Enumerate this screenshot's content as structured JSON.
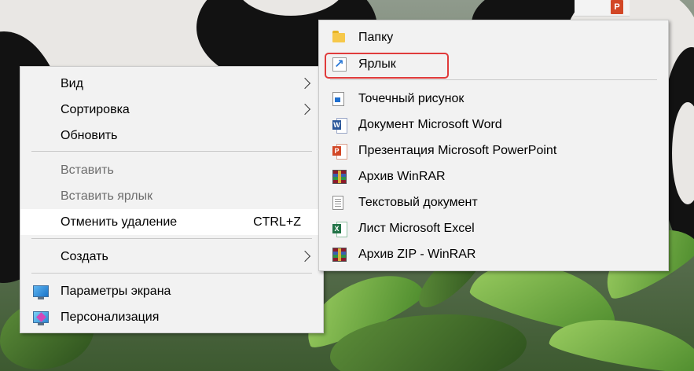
{
  "desktop": {
    "file_tile_icon": "powerpoint-file-icon"
  },
  "context_menu": {
    "items": [
      {
        "label": "Вид",
        "submenu": true,
        "enabled": true
      },
      {
        "label": "Сортировка",
        "submenu": true,
        "enabled": true
      },
      {
        "label": "Обновить",
        "enabled": true
      },
      {
        "label": "Вставить",
        "enabled": false
      },
      {
        "label": "Вставить ярлык",
        "enabled": false
      },
      {
        "label": "Отменить удаление",
        "shortcut": "CTRL+Z",
        "enabled": true,
        "hovered": true
      },
      {
        "label": "Создать",
        "submenu": true,
        "enabled": true,
        "expanded": true
      },
      {
        "label": "Параметры экрана",
        "icon": "display-settings-icon",
        "enabled": true
      },
      {
        "label": "Персонализация",
        "icon": "personalization-icon",
        "enabled": true
      }
    ]
  },
  "create_submenu": {
    "items": [
      {
        "label": "Папку",
        "icon": "folder-icon"
      },
      {
        "label": "Ярлык",
        "icon": "shortcut-icon",
        "highlighted": true
      },
      {
        "label": "Точечный рисунок",
        "icon": "bitmap-icon"
      },
      {
        "label": "Документ Microsoft Word",
        "icon": "word-document-icon"
      },
      {
        "label": "Презентация Microsoft PowerPoint",
        "icon": "powerpoint-icon"
      },
      {
        "label": "Архив WinRAR",
        "icon": "winrar-icon"
      },
      {
        "label": "Текстовый документ",
        "icon": "text-document-icon"
      },
      {
        "label": "Лист Microsoft Excel",
        "icon": "excel-icon"
      },
      {
        "label": "Архив ZIP - WinRAR",
        "icon": "winrar-zip-icon"
      }
    ]
  },
  "colors": {
    "menu_background": "#f2f2f2",
    "hover_background": "#ffffff",
    "highlight_border": "#e03b3b",
    "disabled_text": "#6d6d6d"
  }
}
